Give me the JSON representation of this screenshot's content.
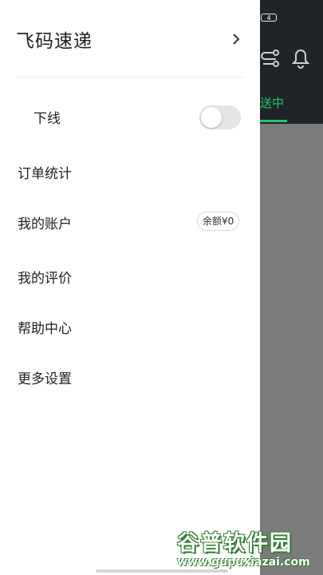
{
  "status_bar": {
    "battery_level": "4"
  },
  "drawer": {
    "title": "飞码速递",
    "offline": {
      "label": "下线",
      "toggle_on": false
    },
    "menu": [
      {
        "label": "订单统计"
      },
      {
        "label": "我的账户",
        "badge": "余额¥0"
      },
      {
        "label": "我的评价"
      },
      {
        "label": "帮助中心"
      },
      {
        "label": "更多设置"
      }
    ]
  },
  "background_app": {
    "tab_label": "送中",
    "accent_color": "#22c56a"
  },
  "watermark": {
    "title": "谷普软件园",
    "url": "www.gupuxiazai.com"
  }
}
